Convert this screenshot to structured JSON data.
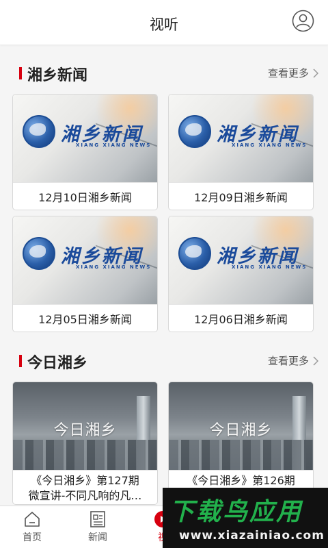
{
  "header": {
    "title": "视听"
  },
  "sections": [
    {
      "title": "湘乡新闻",
      "more_label": "查看更多",
      "cards": [
        {
          "caption": "12月10日湘乡新闻",
          "thumb_logo": "湘乡新闻",
          "thumb_sub": "XIANG XIANG NEWS"
        },
        {
          "caption": "12月09日湘乡新闻",
          "thumb_logo": "湘乡新闻",
          "thumb_sub": "XIANG XIANG NEWS"
        },
        {
          "caption": "12月05日湘乡新闻",
          "thumb_logo": "湘乡新闻",
          "thumb_sub": "XIANG XIANG NEWS"
        },
        {
          "caption": "12月06日湘乡新闻",
          "thumb_logo": "湘乡新闻",
          "thumb_sub": "XIANG XIANG NEWS"
        }
      ]
    },
    {
      "title": "今日湘乡",
      "more_label": "查看更多",
      "cards": [
        {
          "thumb_title": "今日湘乡",
          "caption_line1": "《今日湘乡》第127期",
          "caption_line2": "微宣讲-不同凡响的凡…"
        },
        {
          "thumb_title": "今日湘乡",
          "caption_line1": "《今日湘乡》第126期",
          "caption_line2": ""
        }
      ]
    }
  ],
  "tabbar": {
    "items": [
      {
        "label": "首页",
        "icon": "home-icon"
      },
      {
        "label": "新闻",
        "icon": "news-icon"
      },
      {
        "label": "视",
        "icon": "video-icon"
      }
    ]
  },
  "watermark": {
    "main": "下载鸟应用",
    "url": "www.xiazainiao.com"
  },
  "colors": {
    "accent": "#d7000f",
    "header_bg": "#ffffff",
    "page_bg": "#f5f5f5",
    "logo_blue": "#1a4a9b",
    "watermark_green": "#22b14c"
  },
  "icons": {
    "user": "user-icon",
    "chevron": "chevron-right-icon"
  }
}
